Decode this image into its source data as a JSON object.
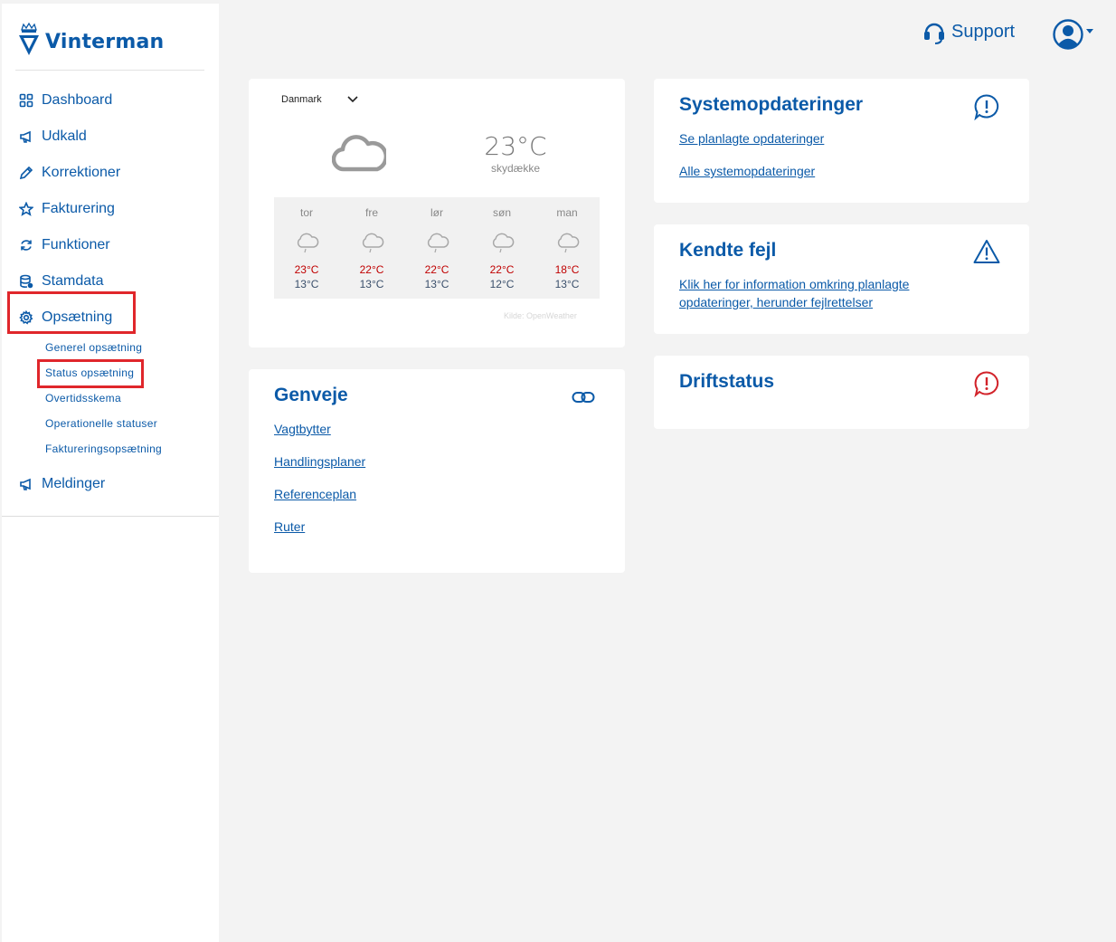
{
  "brand": {
    "name": "Vinterman"
  },
  "sidebar": {
    "items": [
      {
        "label": "Dashboard",
        "icon": "grid-icon"
      },
      {
        "label": "Udkald",
        "icon": "megaphone-icon"
      },
      {
        "label": "Korrektioner",
        "icon": "pencil-icon"
      },
      {
        "label": "Fakturering",
        "icon": "star-icon"
      },
      {
        "label": "Funktioner",
        "icon": "refresh-icon"
      },
      {
        "label": "Stamdata",
        "icon": "database-icon"
      },
      {
        "label": "Opsætning",
        "icon": "gear-icon",
        "highlighted": true
      },
      {
        "label": "Meldinger",
        "icon": "megaphone-icon"
      }
    ],
    "subitems": [
      {
        "label": "Generel opsætning"
      },
      {
        "label": "Status opsætning",
        "highlighted": true
      },
      {
        "label": "Overtidsskema"
      },
      {
        "label": "Operationelle statuser"
      },
      {
        "label": "Faktureringsopsætning"
      }
    ]
  },
  "header": {
    "support_label": "Support"
  },
  "weather": {
    "country": "Danmark",
    "current_temp": "23°C",
    "current_desc": "skydække",
    "forecast": [
      {
        "day": "tor",
        "max": "23°C",
        "min": "13°C"
      },
      {
        "day": "fre",
        "max": "22°C",
        "min": "13°C"
      },
      {
        "day": "lør",
        "max": "22°C",
        "min": "13°C"
      },
      {
        "day": "søn",
        "max": "22°C",
        "min": "12°C"
      },
      {
        "day": "man",
        "max": "18°C",
        "min": "13°C"
      }
    ],
    "source": "Kilde: OpenWeather"
  },
  "shortcuts": {
    "title": "Genveje",
    "links": [
      "Vagtbytter",
      "Handlingsplaner",
      "Referenceplan",
      "Ruter"
    ]
  },
  "system_updates": {
    "title": "Systemopdateringer",
    "links": [
      "Se planlagte opdateringer",
      "Alle systemopdateringer"
    ]
  },
  "known_errors": {
    "title": "Kendte fejl",
    "link": "Klik her for information omkring planlagte opdateringer, herunder fejlrettelser"
  },
  "operation_status": {
    "title": "Driftstatus"
  },
  "colors": {
    "brand_blue": "#0b5aa8",
    "highlight_red": "#e0262b",
    "alert_red": "#d2232a",
    "max_temp_red": "#c00000"
  }
}
